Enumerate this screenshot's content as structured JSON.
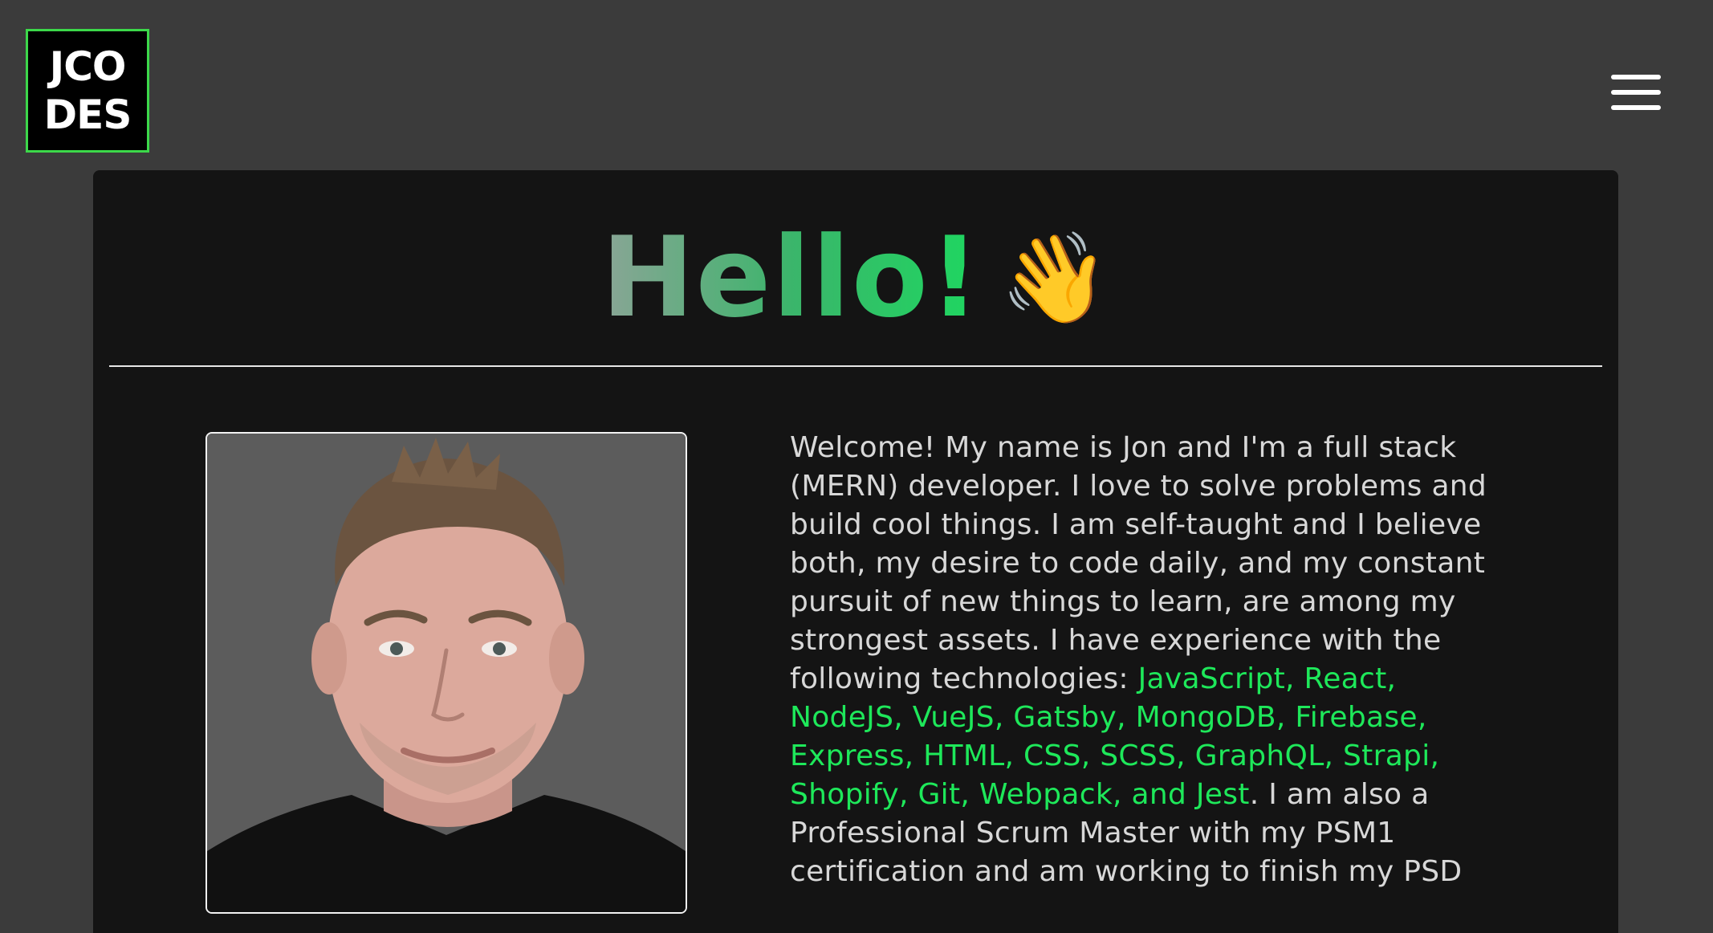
{
  "logo": {
    "line1": "JCO",
    "line2": "DES"
  },
  "header": {
    "greeting": "Hello!",
    "wave_emoji": "👋"
  },
  "bio": {
    "intro": "Welcome! My name is Jon and I'm a full stack (MERN) developer. I love to solve problems and build cool things. I am self-taught and I believe both, my desire to code daily, and my constant pursuit of new things to learn, are among my strongest assets. I have experience with the following technologies: ",
    "technologies": "JavaScript, React, NodeJS, VueJS, Gatsby, MongoDB, Firebase, Express, HTML, CSS, SCSS, GraphQL, Strapi, Shopify, Git, Webpack, and Jest",
    "outro": ". I am also a Professional Scrum Master with my PSM1 certification and am working to finish my PSD"
  },
  "colors": {
    "accent": "#1ee85a",
    "logo_border": "#3cd84a",
    "page_bg": "#3b3b3b",
    "card_bg": "#141414"
  },
  "icons": {
    "menu": "hamburger-menu-icon",
    "wave": "waving-hand-icon"
  }
}
